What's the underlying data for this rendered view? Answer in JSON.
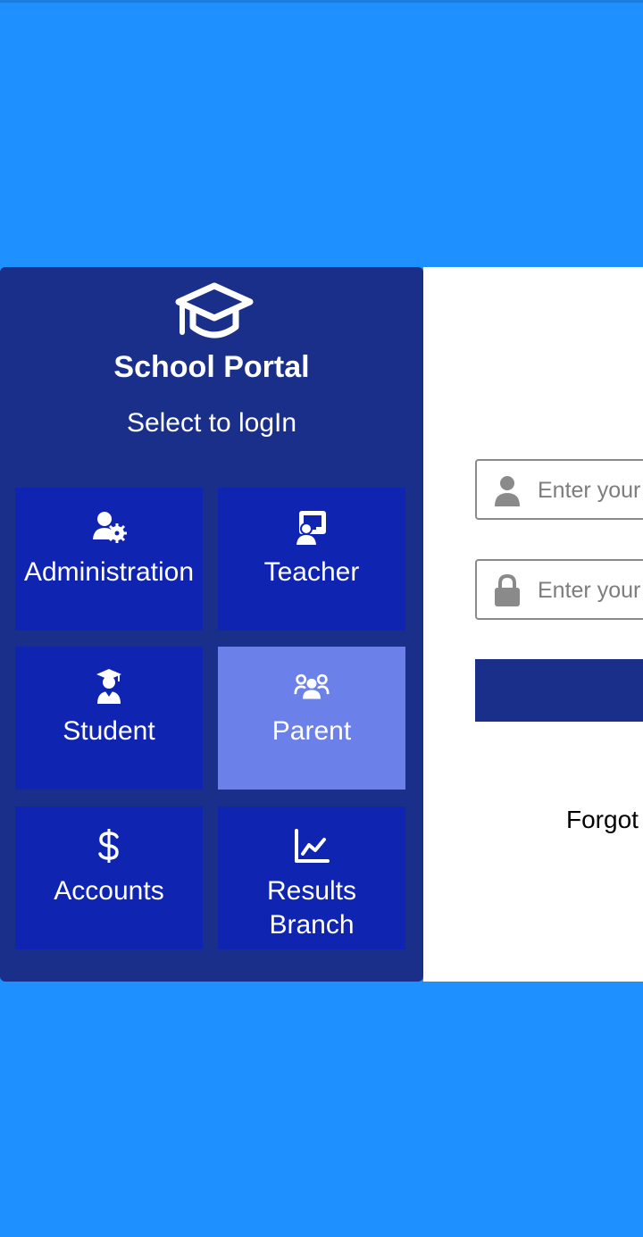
{
  "sidebar": {
    "title": "School Portal",
    "subtitle": "Select to logIn",
    "logo_icon": "graduation-cap-icon"
  },
  "roles": [
    {
      "label": "Administration",
      "icon": "user-gear-icon",
      "selected": false
    },
    {
      "label": "Teacher",
      "icon": "chalkboard-user-icon",
      "selected": false
    },
    {
      "label": "Student",
      "icon": "user-graduate-icon",
      "selected": false
    },
    {
      "label": "Parent",
      "icon": "users-icon",
      "selected": true
    },
    {
      "label": "Accounts",
      "icon": "dollar-sign-icon",
      "selected": false
    },
    {
      "label": "Results",
      "label_line2": "Branch",
      "icon": "chart-line-icon",
      "selected": false
    }
  ],
  "login": {
    "username_placeholder": "Enter your",
    "password_placeholder": "Enter your",
    "forgot_text": "Forgot"
  },
  "colors": {
    "page_background": "#1e90ff",
    "sidebar": "#1a2f8a",
    "tile": "#0f24b0",
    "tile_selected": "#6b80e8",
    "panel": "#ffffff",
    "button": "#1a2f8a"
  }
}
